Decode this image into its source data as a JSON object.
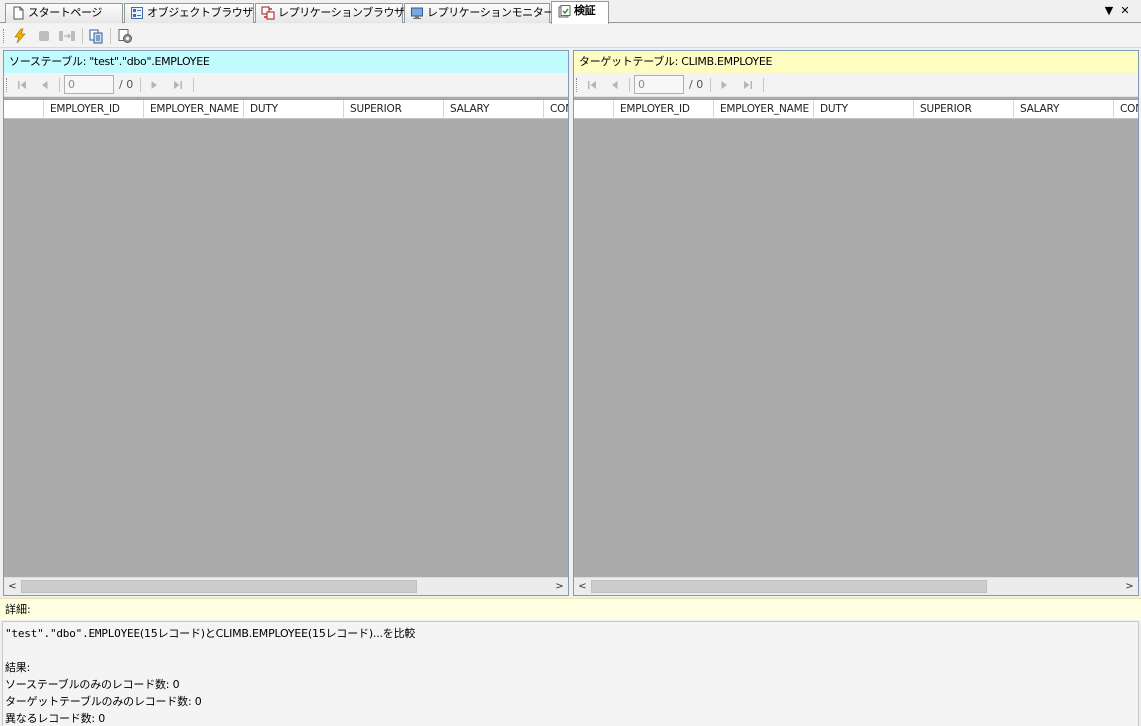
{
  "tabs": [
    {
      "label": "スタートページ",
      "icon": "page-icon"
    },
    {
      "label": "オブジェクトブラウザ",
      "icon": "object-browser-icon"
    },
    {
      "label": "レプリケーションブラウザ",
      "icon": "replication-browser-icon"
    },
    {
      "label": "レプリケーションモニター",
      "icon": "monitor-icon"
    },
    {
      "label": "検証",
      "icon": "verify-icon",
      "active": true
    }
  ],
  "tab_controls": {
    "dropdown": "▼",
    "close": "✕"
  },
  "toolbar": {
    "buttons": [
      "run-icon",
      "stop-icon",
      "compare-icon",
      "copy-icon",
      "settings-icon"
    ]
  },
  "source_panel": {
    "title": "ソーステーブル: \"test\".\"dbo\".EMPLOYEE",
    "nav": {
      "position": "0",
      "total": "/ 0"
    },
    "columns": [
      "",
      "EMPLOYER_ID",
      "EMPLOYER_NAME",
      "DUTY",
      "SUPERIOR",
      "SALARY",
      "COM"
    ]
  },
  "target_panel": {
    "title": "ターゲットテーブル: CLIMB.EMPLOYEE",
    "nav": {
      "position": "0",
      "total": "/ 0"
    },
    "columns": [
      "",
      "EMPLOYER_ID",
      "EMPLOYER_NAME",
      "DUTY",
      "SUPERIOR",
      "SALARY",
      "COM"
    ]
  },
  "detail": {
    "label": "詳細:",
    "summary_prefix": "\"test\".\"dbo\".EMPLOYEE",
    "summary_suffix": "(15レコード)とCLIMB.EMPLOYEE(15レコード)...を比較",
    "result_label": "結果:",
    "source_only": "ソーステーブルのみのレコード数: 0",
    "target_only": "ターゲットテーブルのみのレコード数: 0",
    "different": "異なるレコード数: 0"
  },
  "colors": {
    "source_title_bg": "#c2fbfe",
    "target_title_bg": "#fffcc2",
    "detail_label_bg": "#fffee1",
    "grid_bg": "#ababab"
  }
}
